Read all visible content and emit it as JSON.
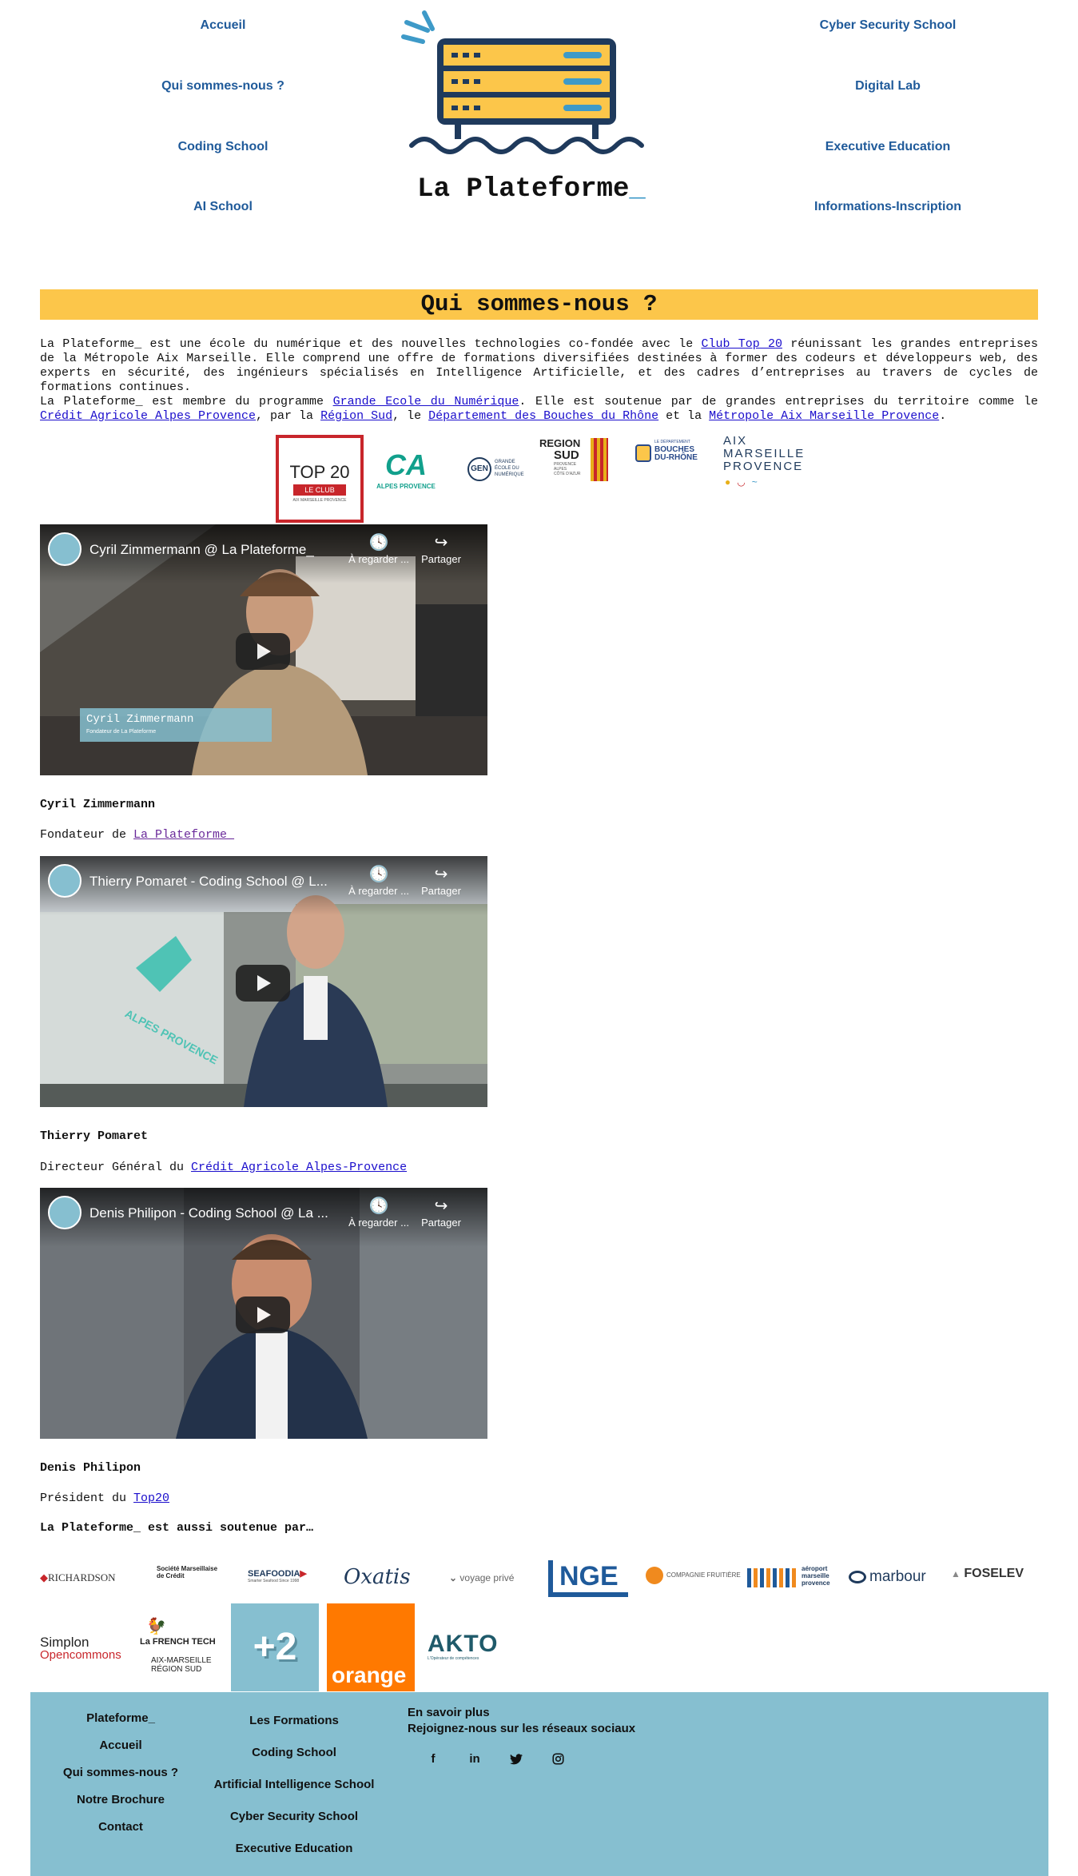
{
  "nav": {
    "left": [
      "Accueil",
      "Qui sommes-nous ?",
      "Coding School",
      "AI School"
    ],
    "right": [
      "Cyber Security School",
      "Digital Lab",
      "Executive Education",
      "Informations-Inscription"
    ]
  },
  "logo": {
    "text": "La Plateforme",
    "suffix": "_"
  },
  "banner": {
    "title": "Qui sommes-nous ?"
  },
  "intro": {
    "p1_a": "La Plateforme_ est une école du numérique et des nouvelles technologies co-fondée avec le ",
    "p1_link": "Club Top 20",
    "p1_b": " réunissant les grandes entreprises de la Métropole Aix Marseille. Elle comprend une offre de formations diversifiées destinées à former des codeurs et développeurs web, des experts en sécurité, des ingénieurs spécialisés en Intelligence Artificielle, et des cadres d’entreprises au travers de cycles de formations continues.",
    "p2_a": "La Plateforme_ est membre du programme ",
    "p2_link1": "Grande Ecole du Numérique",
    "p2_b": ". Elle est soutenue par de grandes entreprises du territoire comme le ",
    "p2_link2": "Crédit Agricole Alpes Provence",
    "p2_c": ", par la ",
    "p2_link3": "Région Sud",
    "p2_d": ", le ",
    "p2_link4": "Département des Bouches du Rhône",
    "p2_e": " et la ",
    "p2_link5": "Métropole Aix Marseille Provence",
    "p2_f": "."
  },
  "partners": {
    "top20": {
      "big": "TOP 20",
      "band": "LE CLUB",
      "small": "AIX MARSEILLE PROVENCE"
    },
    "ca": {
      "mark": "CA",
      "sub": "ALPES PROVENCE"
    },
    "gen": {
      "mark": "GEN",
      "sub1": "GRANDE",
      "sub2": "ÉCOLE DU",
      "sub3": "NUMÉRIQUE"
    },
    "region": {
      "l1": "REGION",
      "l2": "SUD",
      "s1": "PROVENCE",
      "s2": "ALPES",
      "s3": "CÔTE D'AZUR"
    },
    "bdr": {
      "small": "LE DÉPARTEMENT",
      "l1": "BOUCHES",
      "l2": "DU-RHÔNE"
    },
    "amp": {
      "l1": "AIX",
      "l2": "MARSEILLE",
      "l3": "PROVENCE"
    }
  },
  "videos": [
    {
      "title": "Cyril Zimmermann @ La Plateforme_",
      "watch_later": "À regarder ...",
      "share": "Partager",
      "overlay_name": "Cyril Zimmermann",
      "overlay_role": "Fondateur de La Plateforme",
      "person": "Cyril Zimmermann",
      "role_prefix": "Fondateur de ",
      "role_link": "La Plateforme_",
      "colors": {
        "bg": "#4e4a44",
        "accent": "#b59b7a"
      }
    },
    {
      "title": "Thierry Pomaret - Coding School @ L...",
      "watch_later": "À regarder ...",
      "share": "Partager",
      "overlay_name": "",
      "overlay_role": "",
      "person": "Thierry Pomaret",
      "role_prefix": "Directeur Général du ",
      "role_link": "Crédit Agricole Alpes-Provence",
      "wall_text": "ALPES PROVENCE",
      "colors": {
        "bg": "#8e938f",
        "accent": "#2a3a55"
      }
    },
    {
      "title": "Denis Philipon - Coding School @ La ...",
      "watch_later": "À regarder ...",
      "share": "Partager",
      "overlay_name": "",
      "overlay_role": "",
      "person": "Denis Philipon",
      "role_prefix": "Président du ",
      "role_link": "Top20",
      "colors": {
        "bg": "#5a5e63",
        "accent": "#23324a"
      }
    }
  ],
  "sponsors": {
    "title": "La Plateforme_ est aussi soutenue par…",
    "row1": [
      {
        "name": "RICHARDSON"
      },
      {
        "name": "Société Marseillaise de Crédit"
      },
      {
        "name": "SEAFOODIA",
        "sub": "Smarter Seafood Since 1998"
      },
      {
        "name": "Oxatis"
      },
      {
        "name": "voyage privé"
      },
      {
        "name": "NGE"
      },
      {
        "name": "COMPAGNIE FRUITIÈRE"
      },
      {
        "name": "aéroport marseille provence"
      },
      {
        "name": "marbour"
      },
      {
        "name": "FOSELEV"
      }
    ],
    "row2": [
      {
        "name": "Simplon",
        "sub": "Opencommons"
      },
      {
        "name": "La FRENCH TECH",
        "sub": "AIX-MARSEILLE RÉGION SUD"
      },
      {
        "name": "+2"
      },
      {
        "name": "orange"
      },
      {
        "name": "AKTO",
        "sub": "L'Opérateur de compétences"
      }
    ]
  },
  "footer": {
    "col1": [
      "Plateforme_",
      "Accueil",
      "Qui sommes-nous ?",
      "Notre Brochure",
      "Contact"
    ],
    "col2": [
      "Les Formations",
      "Coding School",
      "Artificial Intelligence School",
      "Cyber Security School",
      "Executive Education"
    ],
    "col3": {
      "l1": "En savoir plus",
      "l2": "Rejoignez-nous sur les réseaux sociaux"
    },
    "social": [
      "f",
      "in",
      "twitter",
      "instagram"
    ],
    "bg": "#86bfd0"
  },
  "colors": {
    "yellow": "#fcc64a",
    "navy": "#1f3a5c",
    "nav_blue": "#1f5a9a",
    "link": "#1a0dcc"
  }
}
